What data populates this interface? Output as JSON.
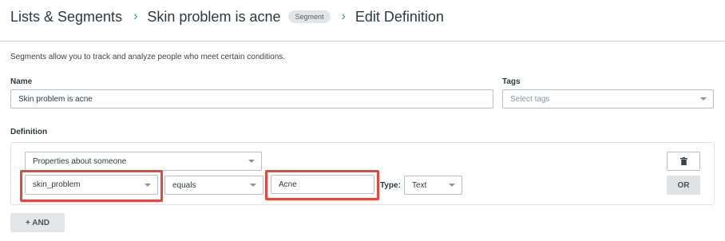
{
  "breadcrumb": {
    "root": "Lists & Segments",
    "segment_name": "Skin problem is acne",
    "badge": "Segment",
    "current": "Edit Definition"
  },
  "intro_text": "Segments allow you to track and analyze people who meet certain conditions.",
  "name_field": {
    "label": "Name",
    "value": "Skin problem is acne"
  },
  "tags_field": {
    "label": "Tags",
    "placeholder": "Select tags"
  },
  "definition": {
    "label": "Definition",
    "condition_type": "Properties about someone",
    "property": "skin_problem",
    "operator": "equals",
    "value": "Acne",
    "type_label": "Type:",
    "type_value": "Text"
  },
  "buttons": {
    "or_label": "OR",
    "and_label": "+ AND"
  },
  "colors": {
    "accent": "#1fa37a",
    "highlight": "#e8453c"
  }
}
